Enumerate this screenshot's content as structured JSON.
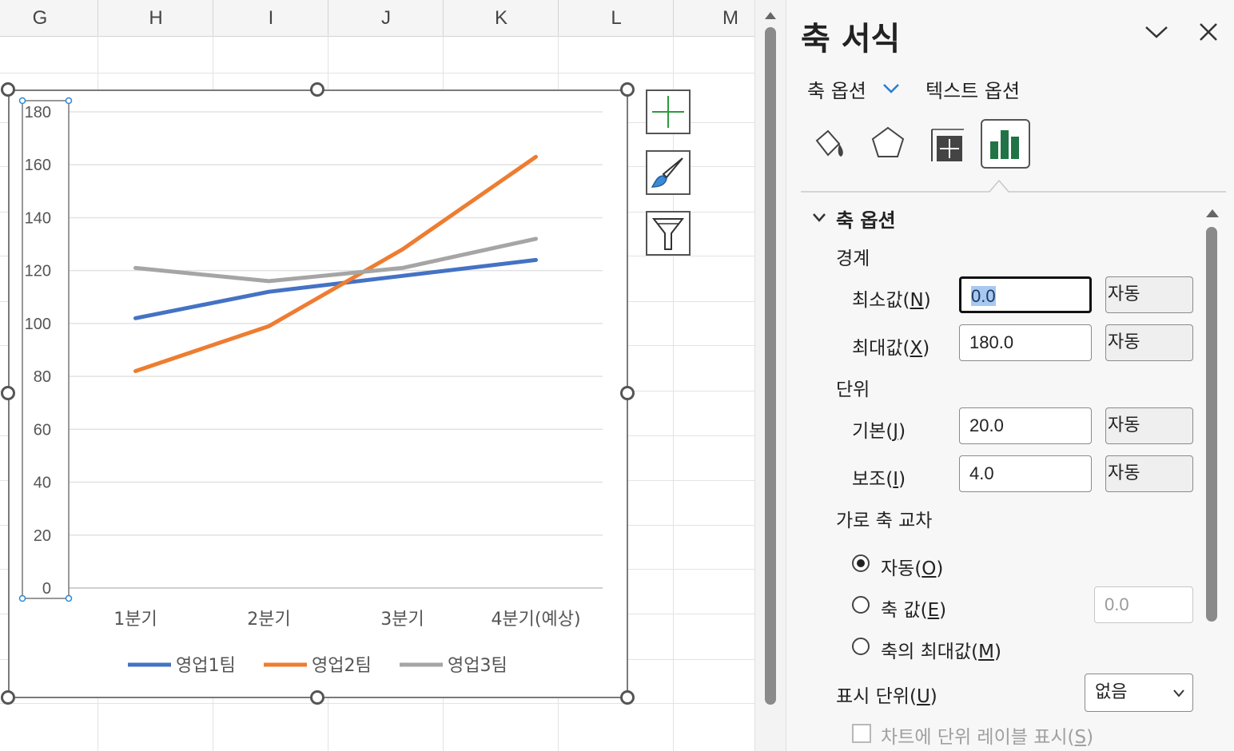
{
  "sheet": {
    "columns": [
      "G",
      "H",
      "I",
      "J",
      "K",
      "L",
      "M"
    ]
  },
  "chart_data": {
    "type": "line",
    "categories": [
      "1분기",
      "2분기",
      "3분기",
      "4분기(예상)"
    ],
    "series": [
      {
        "name": "영업1팀",
        "color": "#4472c4",
        "values": [
          102,
          112,
          118,
          124
        ]
      },
      {
        "name": "영업2팀",
        "color": "#ed7d31",
        "values": [
          82,
          99,
          128,
          163
        ]
      },
      {
        "name": "영업3팀",
        "color": "#a5a5a5",
        "values": [
          121,
          116,
          121,
          132
        ]
      }
    ],
    "ylim": [
      0,
      180
    ],
    "y_ticks": [
      "180",
      "160",
      "140",
      "120",
      "100",
      "80",
      "60",
      "40",
      "20",
      "0"
    ],
    "grid": true,
    "legend": "bottom"
  },
  "chart_buttons": {
    "icons": [
      "plus-icon",
      "brush-icon",
      "filter-icon"
    ]
  },
  "pane": {
    "title": "축 서식",
    "tab_axis_options": "축 옵션",
    "tab_text_options": "텍스트 옵션",
    "icon_tabs": [
      "fill-line-icon",
      "effects-pentagon-icon",
      "size-properties-icon",
      "axis-options-chart-icon"
    ],
    "section_title": "축 옵션",
    "bounds_label": "경계",
    "min_label": "최소값(",
    "min_key": "N",
    "min_value": "0.0",
    "max_label": "최대값(",
    "max_key": "X",
    "max_value": "180.0",
    "units_label": "단위",
    "major_label": "기본(",
    "major_key": "J",
    "major_value": "20.0",
    "minor_label": "보조(",
    "minor_key": "I",
    "minor_value": "4.0",
    "auto_label": "자동",
    "cross_label": "가로 축 교차",
    "radio_auto": "자동(",
    "radio_auto_key": "O",
    "radio_value": "축 값(",
    "radio_value_key": "E",
    "radio_value_input": "0.0",
    "radio_max": "축의 최대값(",
    "radio_max_key": "M",
    "display_units_label": "표시 단위(",
    "display_units_key": "U",
    "display_units_value": "없음",
    "show_units_label": "차트에 단위 레이블 표시(",
    "show_units_key": "S",
    "close_paren": ")"
  }
}
